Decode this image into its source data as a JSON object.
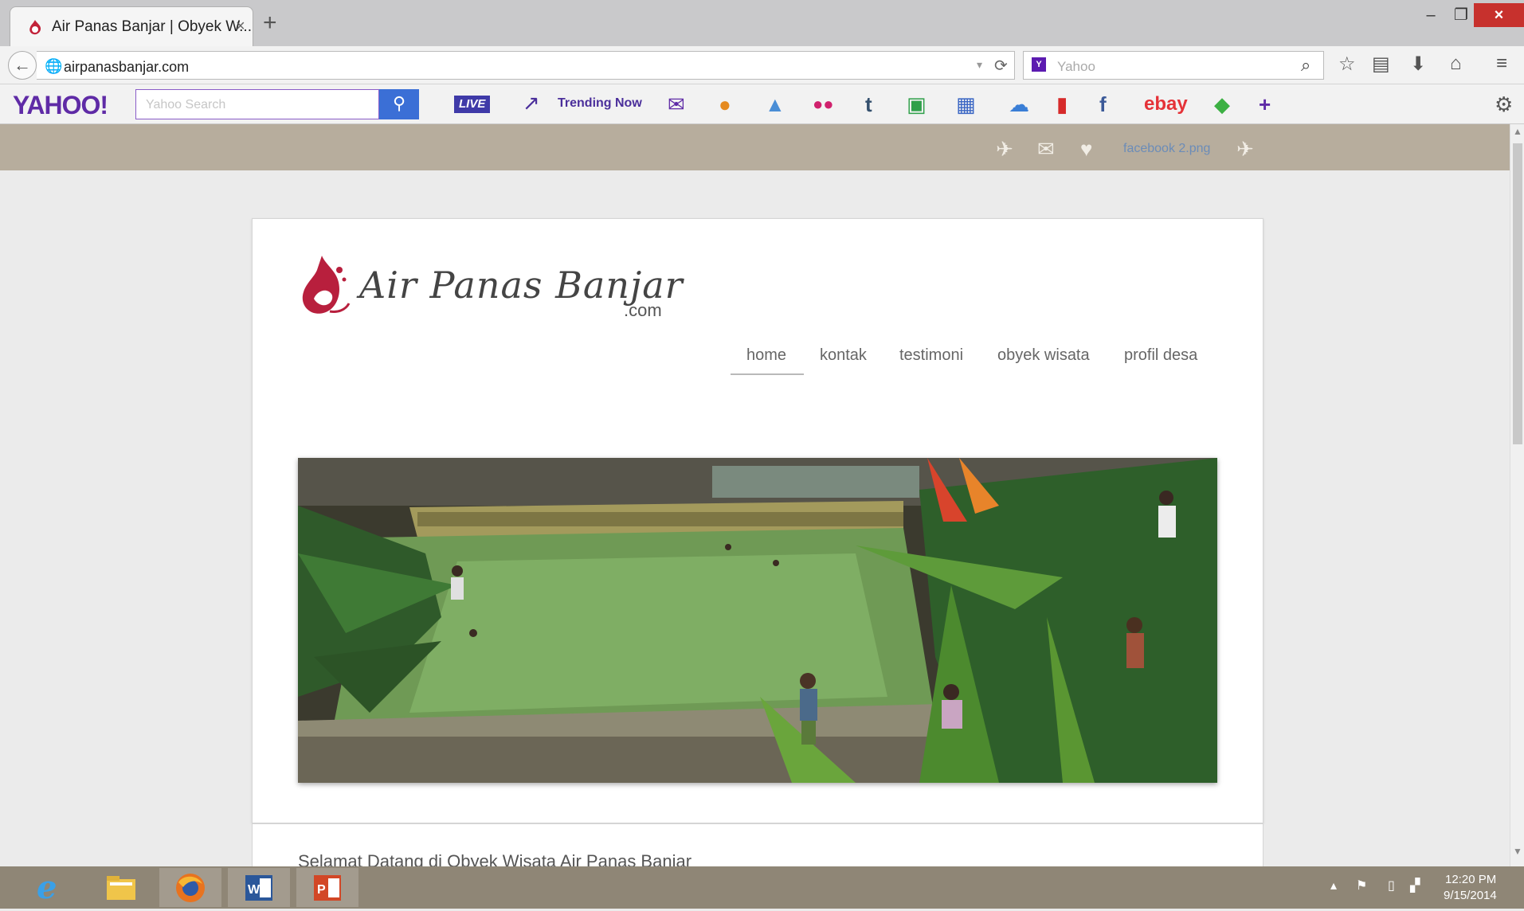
{
  "browser": {
    "tab_title": "Air Panas Banjar | Obyek W...",
    "tab_close": "×",
    "new_tab": "+",
    "window_controls": {
      "minimize": "–",
      "maximize": "❐",
      "close": "×"
    },
    "url": "airpanasbanjar.com",
    "search_engine": "Yahoo",
    "search_engine_icon": "yahoo-icon"
  },
  "yahoo_toolbar": {
    "logo": "YAHOO!",
    "search_placeholder": "Yahoo Search",
    "live_label": "LIVE",
    "trending_label": "Trending Now",
    "ebay_label": "ebay",
    "tumblr_label": "t",
    "more_label": "+"
  },
  "banner": {
    "broken_image_label": "facebook 2.png"
  },
  "site": {
    "logo_title": "Air Panas Banjar",
    "logo_suffix": ".com",
    "menu": [
      {
        "label": "home",
        "active": true
      },
      {
        "label": "kontak",
        "active": false
      },
      {
        "label": "testimoni",
        "active": false
      },
      {
        "label": "obyek wisata",
        "active": false
      },
      {
        "label": "profil desa",
        "active": false
      }
    ],
    "welcome_heading": "Selamat Datang di Obyek Wisata Air Panas Banjar"
  },
  "taskbar": {
    "apps": [
      "internet-explorer-icon",
      "file-explorer-icon",
      "firefox-icon",
      "word-icon",
      "powerpoint-icon"
    ],
    "time": "12:20 PM",
    "date": "9/15/2014"
  },
  "colors": {
    "yahoo_purple": "#5f2ba6",
    "search_blue": "#3b6fd6",
    "close_red": "#c7312d",
    "banner_tan": "#b7ad9d",
    "pool_green": "#6f9a55"
  }
}
